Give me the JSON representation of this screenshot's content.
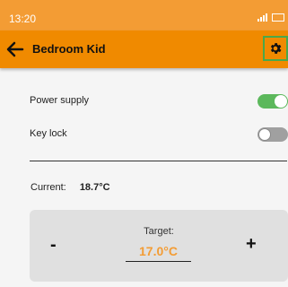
{
  "status_bar": {
    "time": "13:20"
  },
  "app_bar": {
    "title": "Bedroom Kid"
  },
  "settings": [
    {
      "label": "Power supply",
      "state": "on"
    },
    {
      "label": "Key lock",
      "state": "off"
    }
  ],
  "current": {
    "label": "Current:",
    "value": "18.7°C"
  },
  "target": {
    "label": "Target:",
    "value": "17.0°C",
    "decrement_label": "-",
    "increment_label": "+"
  },
  "colors": {
    "status_bar": "#f39c34",
    "app_bar": "#f08a00",
    "toggle_on": "#5cb85c",
    "toggle_off": "#a0a0a0",
    "accent": "#f39c34"
  }
}
